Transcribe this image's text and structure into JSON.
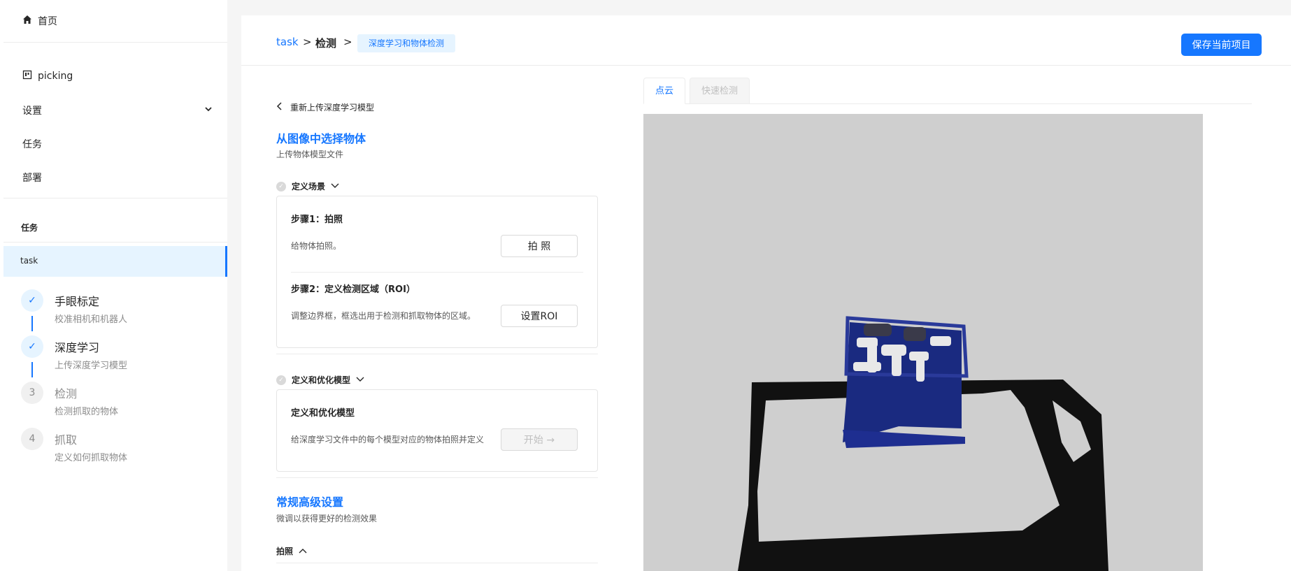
{
  "sidebar": {
    "home_label": "首页",
    "project_label": "picking",
    "settings_label": "设置",
    "tasks_label": "任务",
    "deploy_label": "部署",
    "task_section_title": "任务",
    "current_task": "task",
    "steps": [
      {
        "number": "✓",
        "title": "手眼标定",
        "desc": "校准相机和机器人",
        "status": "done"
      },
      {
        "number": "✓",
        "title": "深度学习",
        "desc": "上传深度学习模型",
        "status": "done"
      },
      {
        "number": "3",
        "title": "检测",
        "desc": "检测抓取的物体",
        "status": "todo"
      },
      {
        "number": "4",
        "title": "抓取",
        "desc": "定义如何抓取物体",
        "status": "todo"
      }
    ]
  },
  "header": {
    "breadcrumb_task": "task",
    "breadcrumb_sep": ">",
    "breadcrumb_detect": "检测",
    "breadcrumb_current": "深度学习和物体检测",
    "save_button": "保存当前项目"
  },
  "panel": {
    "back_label": "重新上传深度学习模型",
    "title": "从图像中选择物体",
    "subtitle": "上传物体模型文件",
    "scene_section": "定义场景",
    "step1_title": "步骤1：拍照",
    "step1_desc": "给物体拍照。",
    "step1_button": "拍 照",
    "step2_title": "步骤2：定义检测区域（ROI）",
    "step2_desc": "调整边界框，框选出用于检测和抓取物体的区域。",
    "step2_button": "设置ROI",
    "model_section": "定义和优化模型",
    "model_card_title": "定义和优化模型",
    "model_card_desc": "给深度学习文件中的每个模型对应的物体拍照并定义",
    "model_button": "开始 →",
    "advanced_title": "常规高级设置",
    "advanced_subtitle": "微调以获得更好的检测效果",
    "photo_section": "拍照"
  },
  "viewer": {
    "tab_pointcloud": "点云",
    "tab_quick_detect": "快速检测"
  },
  "colors": {
    "accent": "#1677ff",
    "active_bg": "#e6f4ff",
    "viewer_bg": "#cfcfcf"
  }
}
